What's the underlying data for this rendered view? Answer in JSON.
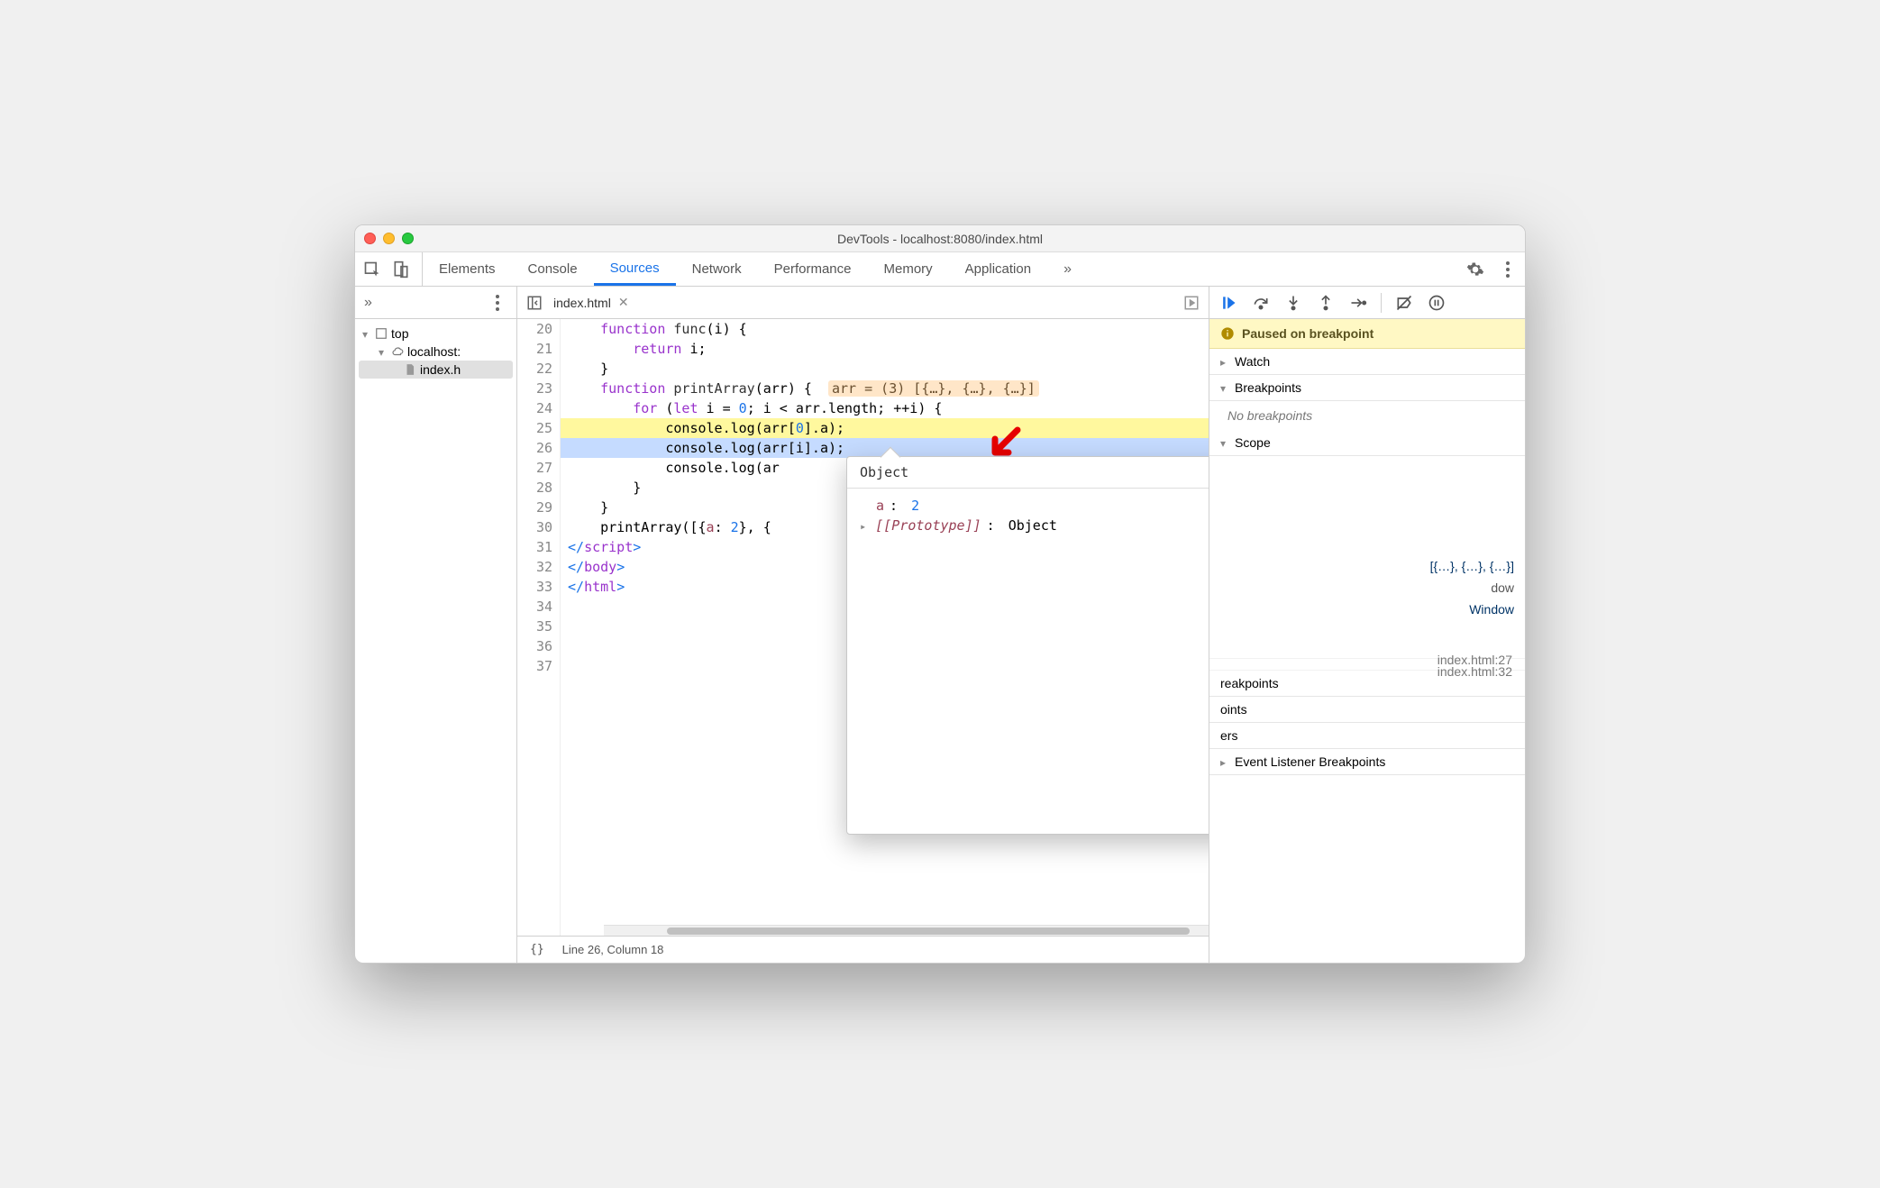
{
  "window": {
    "title": "DevTools - localhost:8080/index.html"
  },
  "tabs": {
    "elements": "Elements",
    "console": "Console",
    "sources": "Sources",
    "network": "Network",
    "performance": "Performance",
    "memory": "Memory",
    "application": "Application"
  },
  "sidebar": {
    "top": "top",
    "origin": "localhost:",
    "file": "index.h"
  },
  "editor": {
    "filename": "index.html",
    "startLine": 20,
    "inline_arr": "arr = (3) [{…}, {…}, {…}]",
    "lines": [
      {
        "n": 20,
        "html": "    <span class='kw'>function</span> <span class='fn'>func</span>(i) {"
      },
      {
        "n": 21,
        "html": "        <span class='kw'>return</span> i;"
      },
      {
        "n": 22,
        "html": "    }"
      },
      {
        "n": 23,
        "html": ""
      },
      {
        "n": 24,
        "html": "    <span class='kw'>function</span> <span class='fn'>printArray</span>(arr) {  <span class='inline-arr' data-bind='editor.inline_arr'></span>"
      },
      {
        "n": 25,
        "html": "        <span class='kw'>for</span> (<span class='kw'>let</span> i = <span class='num'>0</span>; i < arr.length; ++i) {"
      },
      {
        "n": 26,
        "html": "            console.log(arr[<span class='num'>0</span>].a);",
        "cls": "hl-yellow"
      },
      {
        "n": 27,
        "html": "            console.log(arr[i].a);",
        "cls": "hl-blue"
      },
      {
        "n": 28,
        "html": "            console.log(ar"
      },
      {
        "n": 29,
        "html": "        }"
      },
      {
        "n": 30,
        "html": "    }"
      },
      {
        "n": 31,
        "html": ""
      },
      {
        "n": 32,
        "html": "    printArray([{<span class='prop'>a</span>: <span class='num'>2</span>}, {"
      },
      {
        "n": 33,
        "html": ""
      },
      {
        "n": 34,
        "html": "<span class='tag'>&lt;/</span><span class='tagname'>script</span><span class='tag'>&gt;</span>"
      },
      {
        "n": 35,
        "html": "<span class='tag'>&lt;/</span><span class='tagname'>body</span><span class='tag'>&gt;</span>"
      },
      {
        "n": 36,
        "html": "<span class='tag'>&lt;/</span><span class='tagname'>html</span><span class='tag'>&gt;</span>"
      },
      {
        "n": 37,
        "html": ""
      }
    ]
  },
  "statusbar": {
    "pos": "Line 26, Column 18"
  },
  "debug": {
    "paused": "Paused on breakpoint",
    "watch": "Watch",
    "breakpoints": "Breakpoints",
    "no_breakpoints": "No breakpoints",
    "scope": "Scope",
    "scope_arr": "[{…}, {…}, {…}]",
    "scope_dow": "dow",
    "scope_window": "Window",
    "callstack": [
      {
        "loc": "index.html:27"
      },
      {
        "loc": "index.html:32"
      }
    ],
    "sections": {
      "reakpoints": "reakpoints",
      "oints": "oints",
      "ers": "ers",
      "event": "Event Listener Breakpoints"
    }
  },
  "popup": {
    "header": "Object",
    "prop_key": "a",
    "prop_val": "2",
    "proto_key": "[[Prototype]]",
    "proto_val": "Object"
  }
}
